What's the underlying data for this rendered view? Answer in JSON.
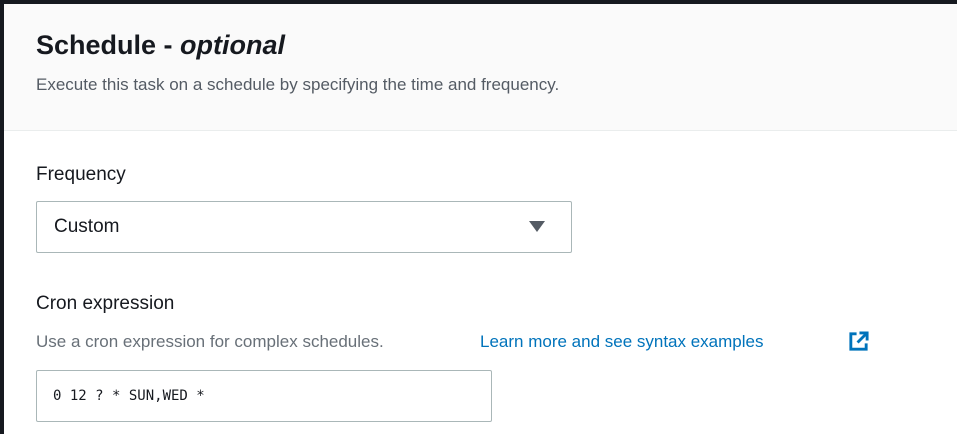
{
  "section": {
    "title_main": "Schedule - ",
    "title_optional": "optional",
    "description": "Execute this task on a schedule by specifying the time and frequency."
  },
  "frequency": {
    "label": "Frequency",
    "selected": "Custom"
  },
  "cron": {
    "label": "Cron expression",
    "hint": "Use a cron expression for complex schedules.",
    "link_text": "Learn more and see syntax examples",
    "value": "0 12 ? * SUN,WED *"
  },
  "icons": {
    "dropdown": "caret-down-icon",
    "external": "external-link-icon"
  },
  "colors": {
    "link": "#0073bb",
    "text": "#16191f",
    "muted": "#545b64"
  }
}
